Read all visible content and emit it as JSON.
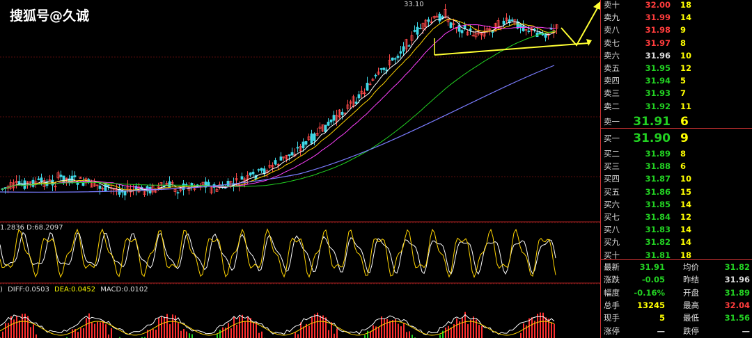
{
  "watermark": "搜狐号@久诚",
  "chart": {
    "peak_label": "33.10",
    "kdj_label": "1.2836 D:68.2097",
    "macd_prefix": ")",
    "macd": {
      "diff": "DIFF:0.0503",
      "dea": "DEA:0.0452",
      "macd": "MACD:0.0102"
    }
  },
  "order_book": {
    "asks": [
      {
        "label": "卖十",
        "price": "32.00",
        "vol": "18",
        "color": "red"
      },
      {
        "label": "卖九",
        "price": "31.99",
        "vol": "14",
        "color": "red"
      },
      {
        "label": "卖八",
        "price": "31.98",
        "vol": "9",
        "color": "red"
      },
      {
        "label": "卖七",
        "price": "31.97",
        "vol": "8",
        "color": "red"
      },
      {
        "label": "卖六",
        "price": "31.96",
        "vol": "10",
        "color": "wht"
      },
      {
        "label": "卖五",
        "price": "31.95",
        "vol": "12",
        "color": "green"
      },
      {
        "label": "卖四",
        "price": "31.94",
        "vol": "5",
        "color": "green"
      },
      {
        "label": "卖三",
        "price": "31.93",
        "vol": "7",
        "color": "green"
      },
      {
        "label": "卖二",
        "price": "31.92",
        "vol": "11",
        "color": "green"
      },
      {
        "label": "卖一",
        "price": "31.91",
        "vol": "6",
        "color": "green"
      }
    ],
    "bids": [
      {
        "label": "买一",
        "price": "31.90",
        "vol": "9",
        "color": "green"
      },
      {
        "label": "买二",
        "price": "31.89",
        "vol": "8",
        "color": "green"
      },
      {
        "label": "买三",
        "price": "31.88",
        "vol": "6",
        "color": "green"
      },
      {
        "label": "买四",
        "price": "31.87",
        "vol": "10",
        "color": "green"
      },
      {
        "label": "买五",
        "price": "31.86",
        "vol": "15",
        "color": "green"
      },
      {
        "label": "买六",
        "price": "31.85",
        "vol": "14",
        "color": "green"
      },
      {
        "label": "买七",
        "price": "31.84",
        "vol": "12",
        "color": "green"
      },
      {
        "label": "买八",
        "price": "31.83",
        "vol": "14",
        "color": "green"
      },
      {
        "label": "买九",
        "price": "31.82",
        "vol": "14",
        "color": "green"
      },
      {
        "label": "买十",
        "price": "31.81",
        "vol": "18",
        "color": "green"
      }
    ]
  },
  "quote_stats": [
    {
      "k1": "最新",
      "v1": "31.91",
      "c1": "green",
      "k2": "均价",
      "v2": "31.82",
      "c2": "green"
    },
    {
      "k1": "涨跌",
      "v1": "-0.05",
      "c1": "green",
      "k2": "昨结",
      "v2": "31.96",
      "c2": "wht"
    },
    {
      "k1": "幅度",
      "v1": "-0.16%",
      "c1": "green",
      "k2": "开盘",
      "v2": "31.89",
      "c2": "green"
    },
    {
      "k1": "总手",
      "v1": "13245",
      "c1": "yel",
      "k2": "最高",
      "v2": "32.04",
      "c2": "red"
    },
    {
      "k1": "现手",
      "v1": "5",
      "c1": "yel",
      "k2": "最低",
      "v2": "31.56",
      "c2": "green"
    },
    {
      "k1": "涨停",
      "v1": "—",
      "c1": "wht",
      "k2": "跌停",
      "v2": "—",
      "c2": "wht"
    }
  ]
}
